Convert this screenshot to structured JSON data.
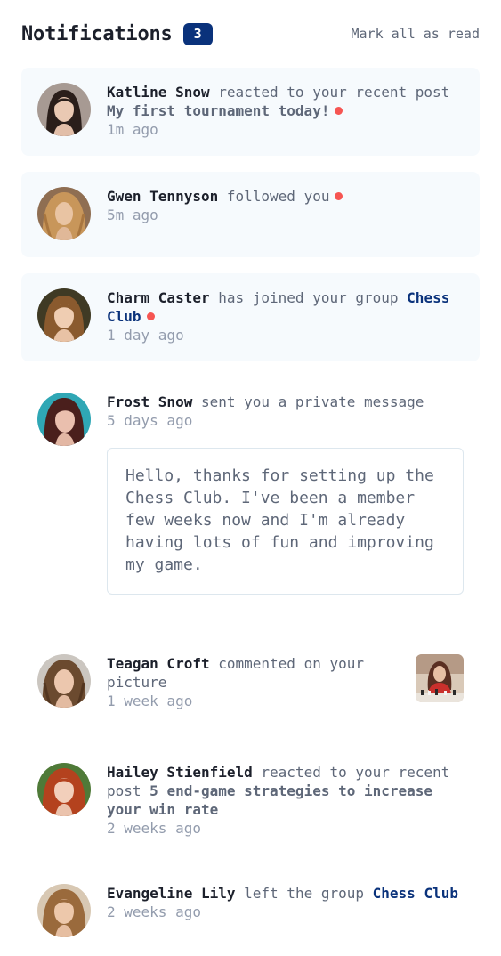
{
  "header": {
    "title": "Notifications",
    "unread_count": "3",
    "mark_all_label": "Mark all as read"
  },
  "colors": {
    "unread_background": "#f6fafd",
    "badge": "#0a327b",
    "unread_dot": "#f65552",
    "group_link": "#0a327b"
  },
  "notifications": [
    {
      "name": "Katline Snow",
      "action": "reacted to your recent post",
      "target": "My first tournament today!",
      "time": "1m ago",
      "unread": true
    },
    {
      "name": "Gwen Tennyson",
      "action": "followed you",
      "time": "5m ago",
      "unread": true
    },
    {
      "name": "Charm Caster",
      "action": "has joined your group",
      "target": "Chess Club",
      "time": "1 day ago",
      "unread": true
    },
    {
      "name": "Frost Snow",
      "action": "sent you a private message",
      "time": "5 days ago",
      "message": "Hello, thanks for setting up the Chess Club. I've been a member few weeks now and I'm already having lots of fun and improving my game.",
      "unread": false
    },
    {
      "name": "Teagan Croft",
      "action": "commented on your picture",
      "time": "1 week ago",
      "unread": false
    },
    {
      "name": "Hailey Stienfield",
      "action": "reacted to your recent post",
      "target": "5 end-game strategies to increase your win rate",
      "time": "2 weeks ago",
      "unread": false
    },
    {
      "name": "Evangeline Lily",
      "action": "left the group",
      "target": "Chess Club",
      "time": "2 weeks ago",
      "unread": false
    }
  ]
}
